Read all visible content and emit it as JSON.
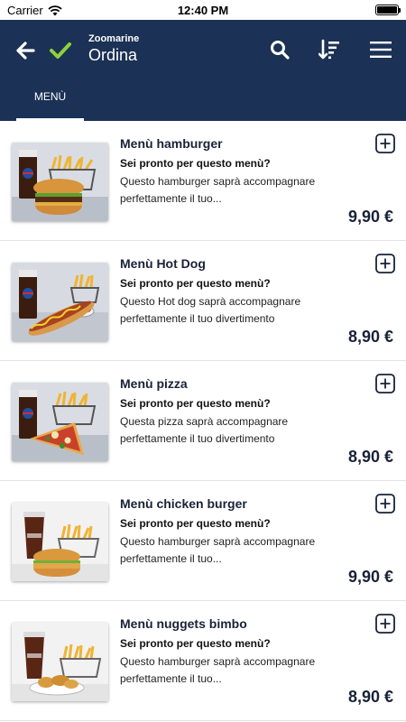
{
  "status_bar": {
    "carrier": "Carrier",
    "time": "12:40 PM"
  },
  "header": {
    "app_name": "Zoomarine",
    "title": "Ordina",
    "icons": [
      "back-arrow-icon",
      "check-icon",
      "search-icon",
      "sort-icon",
      "hamburger-menu-icon"
    ],
    "colors": {
      "bar": "#1b3155",
      "check": "#8ed13c"
    }
  },
  "tabs": [
    {
      "label": "MENÙ",
      "active": true
    }
  ],
  "items": [
    {
      "title": "Menù hamburger",
      "subtitle": "Sei pronto per questo menù?",
      "description": "Questo hamburger saprà accompagnare perfettamente il tuo...",
      "price": "9,90 €",
      "image": "burger-meal-image"
    },
    {
      "title": "Menù Hot Dog",
      "subtitle": "Sei pronto per questo menù?",
      "description": "Questo Hot dog  saprà accompagnare perfettamente il tuo divertimento",
      "price": "8,90 €",
      "image": "hotdog-meal-image"
    },
    {
      "title": "Menù pizza",
      "subtitle": "Sei pronto per questo menù?",
      "description": "Questa pizza saprà accompagnare perfettamente il tuo divertimento",
      "price": "8,90 €",
      "image": "pizza-meal-image"
    },
    {
      "title": "Menù chicken burger",
      "subtitle": "Sei pronto per questo menù?",
      "description": "Questo hamburger saprà accompagnare perfettamente il tuo...",
      "price": "9,90 €",
      "image": "chicken-burger-meal-image"
    },
    {
      "title": "Menù nuggets bimbo",
      "subtitle": "Sei pronto per questo menù?",
      "description": "Questo hamburger saprà accompagnare perfettamente il tuo...",
      "price": "8,90 €",
      "image": "nuggets-meal-image"
    }
  ]
}
